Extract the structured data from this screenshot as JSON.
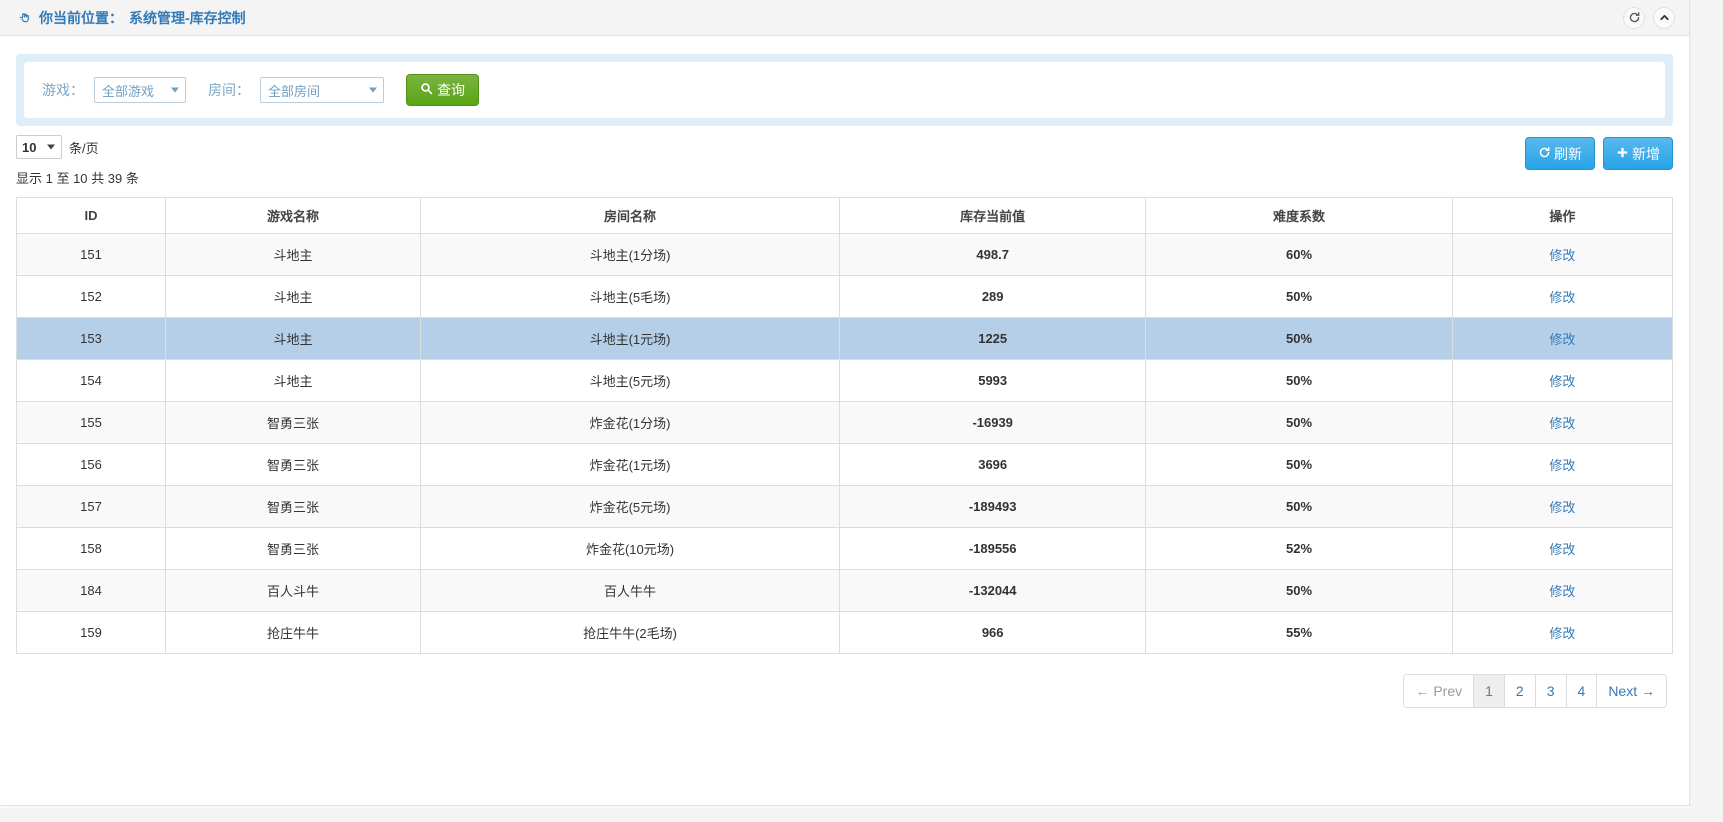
{
  "header": {
    "breadcrumb_prefix": "你当前位置：",
    "breadcrumb_path": "系统管理-库存控制",
    "hand_icon": "pointing-hand-icon",
    "refresh_icon": "refresh-icon",
    "collapse_icon": "chevron-up-icon"
  },
  "filter": {
    "game_label": "游戏：",
    "game_value": "全部游戏",
    "room_label": "房间：",
    "room_value": "全部房间",
    "query_button": "查询",
    "query_icon": "search-icon"
  },
  "toolbar": {
    "page_size": "10",
    "page_size_unit": "条/页",
    "showing": "显示 1 至 10 共 39 条",
    "refresh_button": "刷新",
    "refresh_icon": "refresh-icon",
    "add_button": "新增",
    "add_icon": "plus-icon"
  },
  "table": {
    "columns": [
      "ID",
      "游戏名称",
      "房间名称",
      "库存当前值",
      "难度系数",
      "操作"
    ],
    "action_label": "修改",
    "rows": [
      {
        "id": "151",
        "game": "斗地主",
        "room": "斗地主(1分场)",
        "stock": "498.7",
        "difficulty": "60%",
        "selected": false
      },
      {
        "id": "152",
        "game": "斗地主",
        "room": "斗地主(5毛场)",
        "stock": "289",
        "difficulty": "50%",
        "selected": false
      },
      {
        "id": "153",
        "game": "斗地主",
        "room": "斗地主(1元场)",
        "stock": "1225",
        "difficulty": "50%",
        "selected": true
      },
      {
        "id": "154",
        "game": "斗地主",
        "room": "斗地主(5元场)",
        "stock": "5993",
        "difficulty": "50%",
        "selected": false
      },
      {
        "id": "155",
        "game": "智勇三张",
        "room": "炸金花(1分场)",
        "stock": "-16939",
        "difficulty": "50%",
        "selected": false
      },
      {
        "id": "156",
        "game": "智勇三张",
        "room": "炸金花(1元场)",
        "stock": "3696",
        "difficulty": "50%",
        "selected": false
      },
      {
        "id": "157",
        "game": "智勇三张",
        "room": "炸金花(5元场)",
        "stock": "-189493",
        "difficulty": "50%",
        "selected": false
      },
      {
        "id": "158",
        "game": "智勇三张",
        "room": "炸金花(10元场)",
        "stock": "-189556",
        "difficulty": "52%",
        "selected": false
      },
      {
        "id": "184",
        "game": "百人斗牛",
        "room": "百人牛牛",
        "stock": "-132044",
        "difficulty": "50%",
        "selected": false
      },
      {
        "id": "159",
        "game": "抢庄牛牛",
        "room": "抢庄牛牛(2毛场)",
        "stock": "966",
        "difficulty": "55%",
        "selected": false
      }
    ]
  },
  "pagination": {
    "prev_label": "← Prev",
    "next_label": "Next →",
    "pages": [
      "1",
      "2",
      "3",
      "4"
    ],
    "active_page": "1",
    "prev_disabled": true
  },
  "colors": {
    "accent_blue": "#337ab7",
    "button_blue": "#27a3e8",
    "button_green": "#58a513",
    "selected_row": "#b6cfe8",
    "filter_bg": "#ddeef8"
  }
}
